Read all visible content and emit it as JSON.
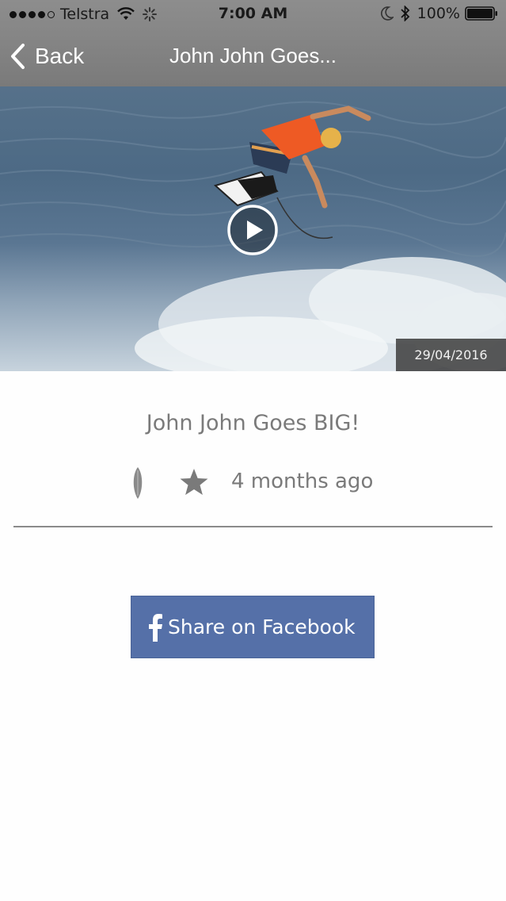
{
  "status_bar": {
    "carrier": "Telstra",
    "time": "7:00 AM",
    "battery": "100%",
    "icons": [
      "signal-icon",
      "wifi-icon",
      "activity-icon",
      "moon-icon",
      "bluetooth-icon",
      "battery-icon"
    ]
  },
  "nav": {
    "back_label": "Back",
    "title": "John John Goes..."
  },
  "video": {
    "date": "29/04/2016",
    "play_icon": "play-icon"
  },
  "post": {
    "title": "John John Goes BIG!",
    "age": "4 months ago",
    "icons": [
      "surfboard-icon",
      "star-icon"
    ]
  },
  "share": {
    "facebook_label": "Share on Facebook",
    "icon": "facebook-icon"
  },
  "colors": {
    "header": "#858585",
    "facebook": "#5570a8",
    "text_gray": "#7a7a7a",
    "date_badge": "#3c3c3c"
  }
}
